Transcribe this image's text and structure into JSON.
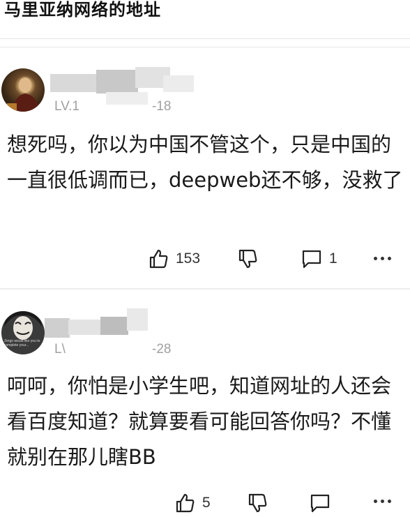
{
  "header": {
    "title": "马里亚纳网络的地址"
  },
  "comments": [
    {
      "level": "LV.1",
      "date_fragment": "-18",
      "text": "想死吗，你以为中国不管这个，只是中国的一直很低调而已，deepweb还不够，没救了",
      "likes": "153",
      "replies": "1",
      "avatar_text": ""
    },
    {
      "level": "L\\",
      "date_fragment": "-28",
      "text": "呵呵，你怕是小学生吧，知道网址的人还会看百度知道？就算要看可能回答你吗？不懂就别在那儿瞎BB",
      "likes": "5",
      "replies": "",
      "avatar_text": "Zergo would like you to complete your..."
    }
  ]
}
